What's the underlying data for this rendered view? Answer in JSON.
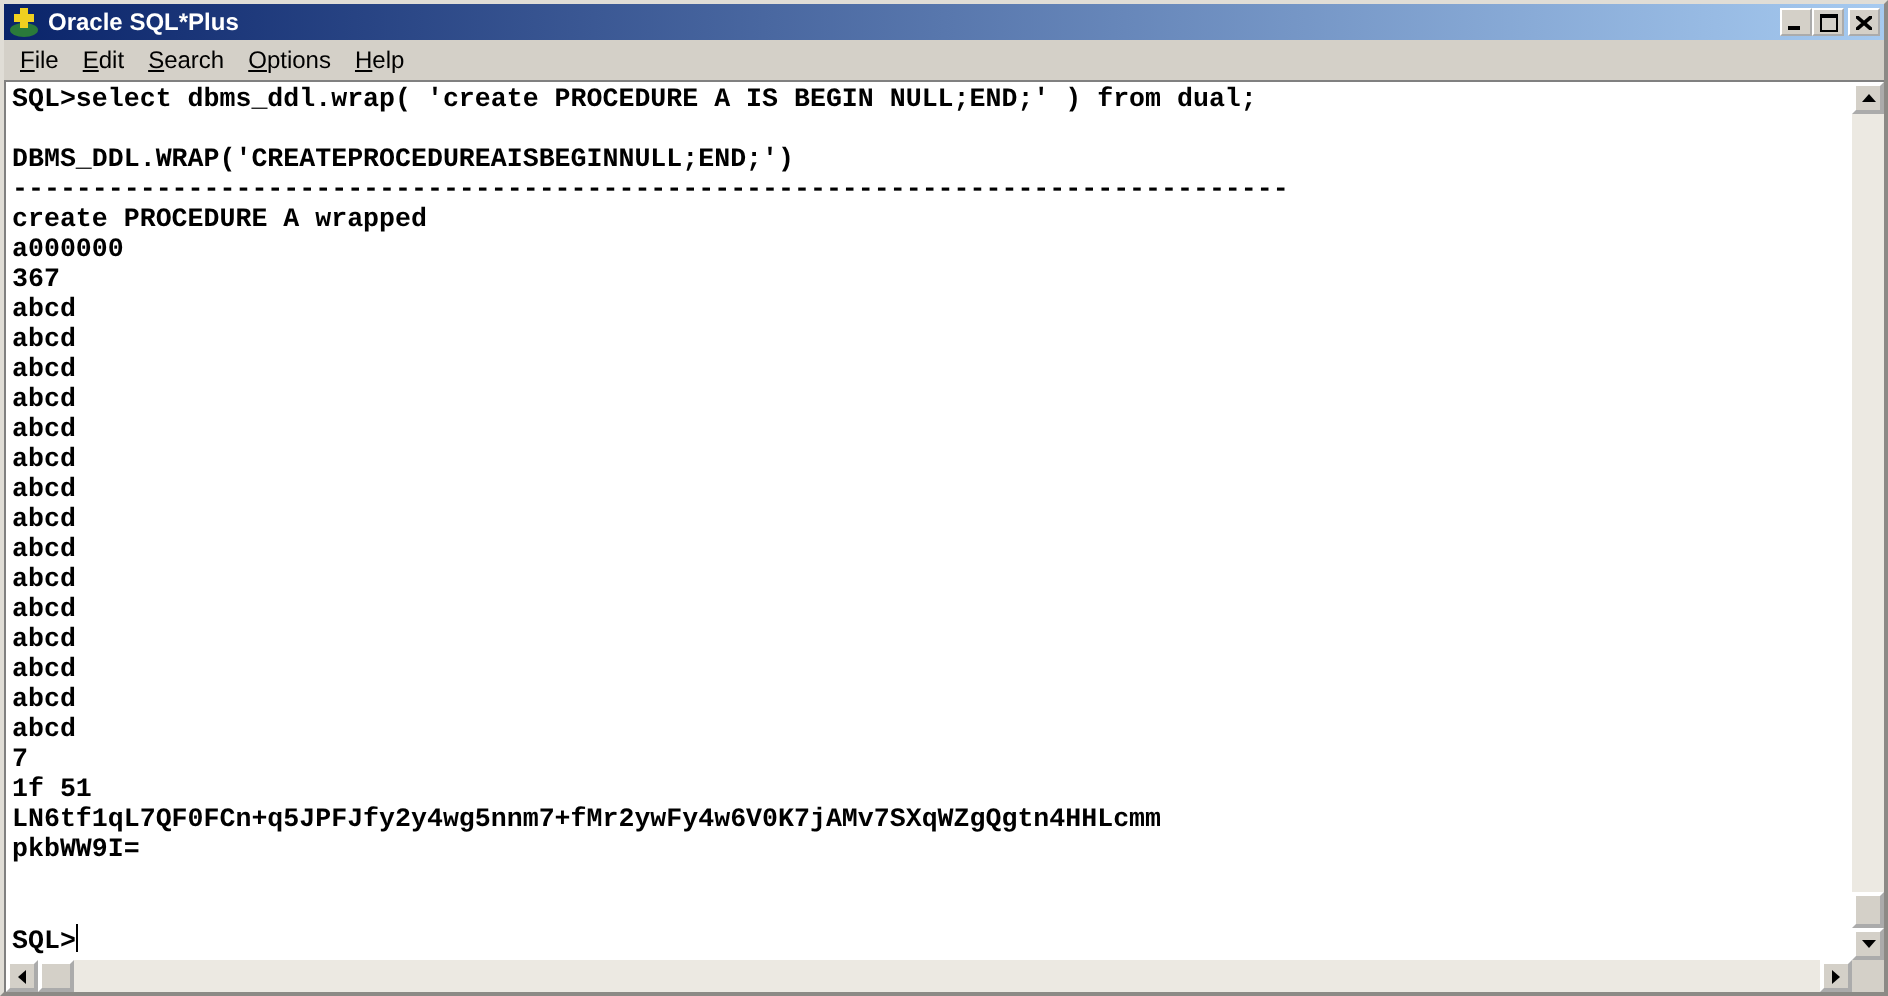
{
  "window": {
    "title": "Oracle SQL*Plus"
  },
  "menu": [
    "File",
    "Edit",
    "Search",
    "Options",
    "Help"
  ],
  "console": {
    "command": "SQL>select dbms_ddl.wrap( 'create PROCEDURE A IS BEGIN NULL;END;' ) from dual;",
    "column_heading": "DBMS_DDL.WRAP('CREATEPROCEDUREAISBEGINNULL;END;')",
    "rule": "--------------------------------------------------------------------------------",
    "output": [
      "create PROCEDURE A wrapped",
      "a000000",
      "367",
      "abcd",
      "abcd",
      "abcd",
      "abcd",
      "abcd",
      "abcd",
      "abcd",
      "abcd",
      "abcd",
      "abcd",
      "abcd",
      "abcd",
      "abcd",
      "abcd",
      "abcd",
      "7",
      "1f 51",
      "LN6tf1qL7QF0FCn+q5JPFJfy2y4wg5nnm7+fMr2ywFy4w6V0K7jAMv7SXqWZgQgtn4HHLcmm",
      "pkbWW9I="
    ],
    "prompt": "SQL>"
  }
}
